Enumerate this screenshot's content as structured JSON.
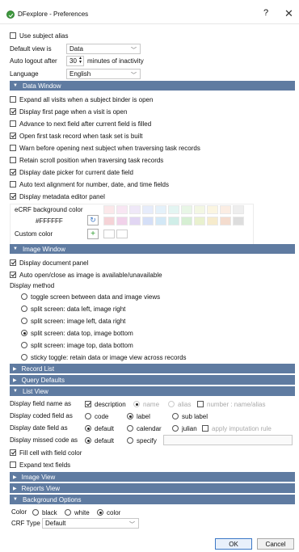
{
  "window": {
    "title": "DFexplore - Preferences",
    "help": "?",
    "close": "✕"
  },
  "top": {
    "use_subject_alias": "Use subject alias",
    "default_view_label": "Default view is",
    "default_view_value": "Data",
    "auto_logout_label": "Auto logout after",
    "auto_logout_value": "30",
    "auto_logout_suffix": "minutes of inactivity",
    "language_label": "Language",
    "language_value": "English"
  },
  "data_window": {
    "header": "Data Window",
    "options": [
      {
        "label": "Expand all visits when a subject binder is open",
        "checked": false
      },
      {
        "label": "Display first page when a visit is open",
        "checked": true
      },
      {
        "label": "Advance to next field after current field is filled",
        "checked": false
      },
      {
        "label": "Open first task record when task set is built",
        "checked": true
      },
      {
        "label": "Warn before opening next subject when traversing task records",
        "checked": false
      },
      {
        "label": "Retain scroll position when traversing task records",
        "checked": false
      },
      {
        "label": "Display date picker for current date field",
        "checked": true
      },
      {
        "label": "Auto text alignment for number, date, and time fields",
        "checked": false
      },
      {
        "label": "Display metadata editor panel",
        "checked": true
      }
    ],
    "ecrf_bg_label": "eCRF background color",
    "ecrf_bg_value": "#FFFFFF",
    "custom_color_label": "Custom color"
  },
  "image_window": {
    "header": "Image Window",
    "display_document_panel": "Display document panel",
    "auto_open_close": "Auto open/close as image is available/unavailable",
    "display_method_label": "Display method",
    "methods": [
      {
        "label": "toggle screen between data and image views",
        "selected": false
      },
      {
        "label": "split screen: data left, image right",
        "selected": false
      },
      {
        "label": "split screen: image left, data right",
        "selected": false
      },
      {
        "label": "split screen: data top, image bottom",
        "selected": true
      },
      {
        "label": "split screen: image top, data bottom",
        "selected": false
      },
      {
        "label": "sticky toggle: retain data or image view across records",
        "selected": false
      }
    ]
  },
  "record_list": {
    "header": "Record List"
  },
  "query_defaults": {
    "header": "Query Defaults"
  },
  "list_view": {
    "header": "List View",
    "field_name_label": "Display field name as",
    "field_name_description": "description",
    "field_name_name": "name",
    "field_name_alias": "alias",
    "field_name_number": "number : name/alias",
    "coded_label": "Display coded field as",
    "coded_code": "code",
    "coded_label_opt": "label",
    "coded_sub_label": "sub label",
    "date_label": "Display date field as",
    "date_default": "default",
    "date_calendar": "calendar",
    "date_julian": "julian",
    "date_imputation": "apply imputation rule",
    "missed_label": "Display missed code as",
    "missed_default": "default",
    "missed_specify": "specify",
    "fill_cell": "Fill cell with field color",
    "expand_text": "Expand text fields"
  },
  "image_view": {
    "header": "Image View"
  },
  "reports_view": {
    "header": "Reports View"
  },
  "background_options": {
    "header": "Background Options",
    "color_label": "Color",
    "black": "black",
    "white": "white",
    "color": "color",
    "crf_type_label": "CRF Type",
    "crf_type_value": "Default"
  },
  "footer": {
    "ok": "OK",
    "cancel": "Cancel"
  },
  "colors": {
    "section_header": "#5f7ba1",
    "accent": "#3c78c6"
  },
  "icons": {
    "collapsed": "triangle-right-icon",
    "expanded": "triangle-down-icon"
  }
}
